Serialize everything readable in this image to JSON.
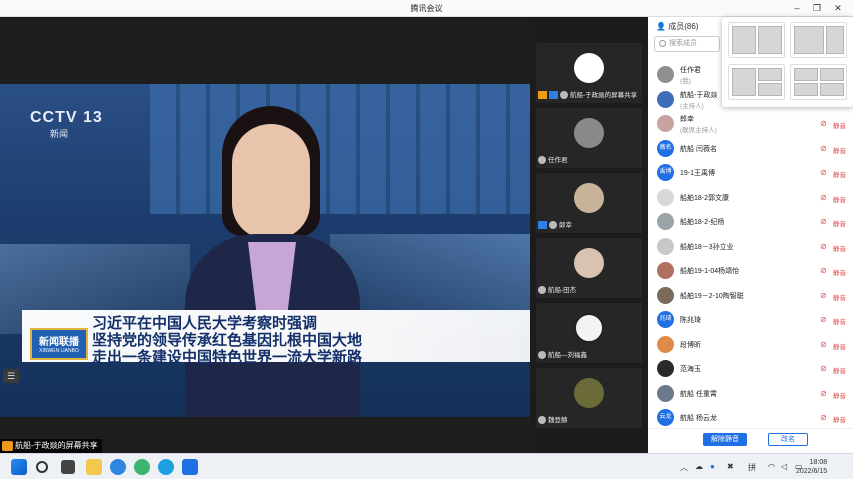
{
  "window": {
    "title": "腾讯会议"
  },
  "stage": {
    "cctv_logo": "CCTV 13",
    "cctv_sub": "新闻",
    "badge": "新闻联播",
    "badge_sub": "XINWEN LIANBO",
    "caption_lines": [
      "习近平在中国人民大学考察时强调",
      "坚持党的领导传承红色基因扎根中国大地",
      "走出一条建设中国特色世界一流大学新路"
    ],
    "share_label": "航船-于政燚的屏幕共享"
  },
  "thumbs": [
    {
      "name": "航船-于政燚的屏幕共享",
      "avatar_color": "#ffffff"
    },
    {
      "name": "任作君",
      "avatar_color": "#8a8a8a"
    },
    {
      "name": "郎幸",
      "avatar_color": "#c7b49a"
    },
    {
      "name": "航船-田杰",
      "avatar_color": "#d9c3b0"
    },
    {
      "name": "航船—刘福鑫",
      "avatar_color": "#f3f3f3"
    },
    {
      "name": "魏登赫",
      "avatar_color": "#6b6b3a"
    }
  ],
  "panel": {
    "header": "成员(86)",
    "search_placeholder": "搜索成员",
    "mute_action": "静音",
    "members": [
      {
        "name": "任作君",
        "role": "(我)",
        "avatar_text": "",
        "color": "#8f8f8f"
      },
      {
        "name": "航船-于政燚",
        "role": "(主持人)",
        "avatar_text": "",
        "color": "#3d6fb8"
      },
      {
        "name": "郎幸",
        "role": "(联席主持人)",
        "avatar_text": "",
        "color": "#c9a3a0"
      },
      {
        "name": "航船 闫薇名",
        "role": "",
        "avatar_text": "薇名",
        "color": "#1f6fe5"
      },
      {
        "name": "19-1王禹博",
        "role": "",
        "avatar_text": "禹博",
        "color": "#1f6fe5"
      },
      {
        "name": "船舶18-2郭文康",
        "role": "",
        "avatar_text": "",
        "color": "#d8d8d8"
      },
      {
        "name": "船舶18-2-纪杨",
        "role": "",
        "avatar_text": "",
        "color": "#9aa3a8"
      },
      {
        "name": "船舶18－3孙立业",
        "role": "",
        "avatar_text": "",
        "color": "#c8c8c8"
      },
      {
        "name": "船舶19-1-04杨靖怡",
        "role": "",
        "avatar_text": "",
        "color": "#b07060"
      },
      {
        "name": "船舶19－2-10陶智聪",
        "role": "",
        "avatar_text": "",
        "color": "#7a6a5a"
      },
      {
        "name": "陈兆琦",
        "role": "",
        "avatar_text": "兆琦",
        "color": "#1f6fe5"
      },
      {
        "name": "段博昕",
        "role": "",
        "avatar_text": "",
        "color": "#e08a4a"
      },
      {
        "name": "范海玉",
        "role": "",
        "avatar_text": "",
        "color": "#2a2a2a"
      },
      {
        "name": "航船 任重霄",
        "role": "",
        "avatar_text": "",
        "color": "#6a7a8a"
      },
      {
        "name": "航船 杨云龙",
        "role": "",
        "avatar_text": "云龙",
        "color": "#1f6fe5"
      }
    ],
    "unmute_all": "解除静音",
    "rename": "改名"
  },
  "taskbar": {
    "ime": "拼",
    "time": "18:08",
    "date": "2022/6/15"
  }
}
